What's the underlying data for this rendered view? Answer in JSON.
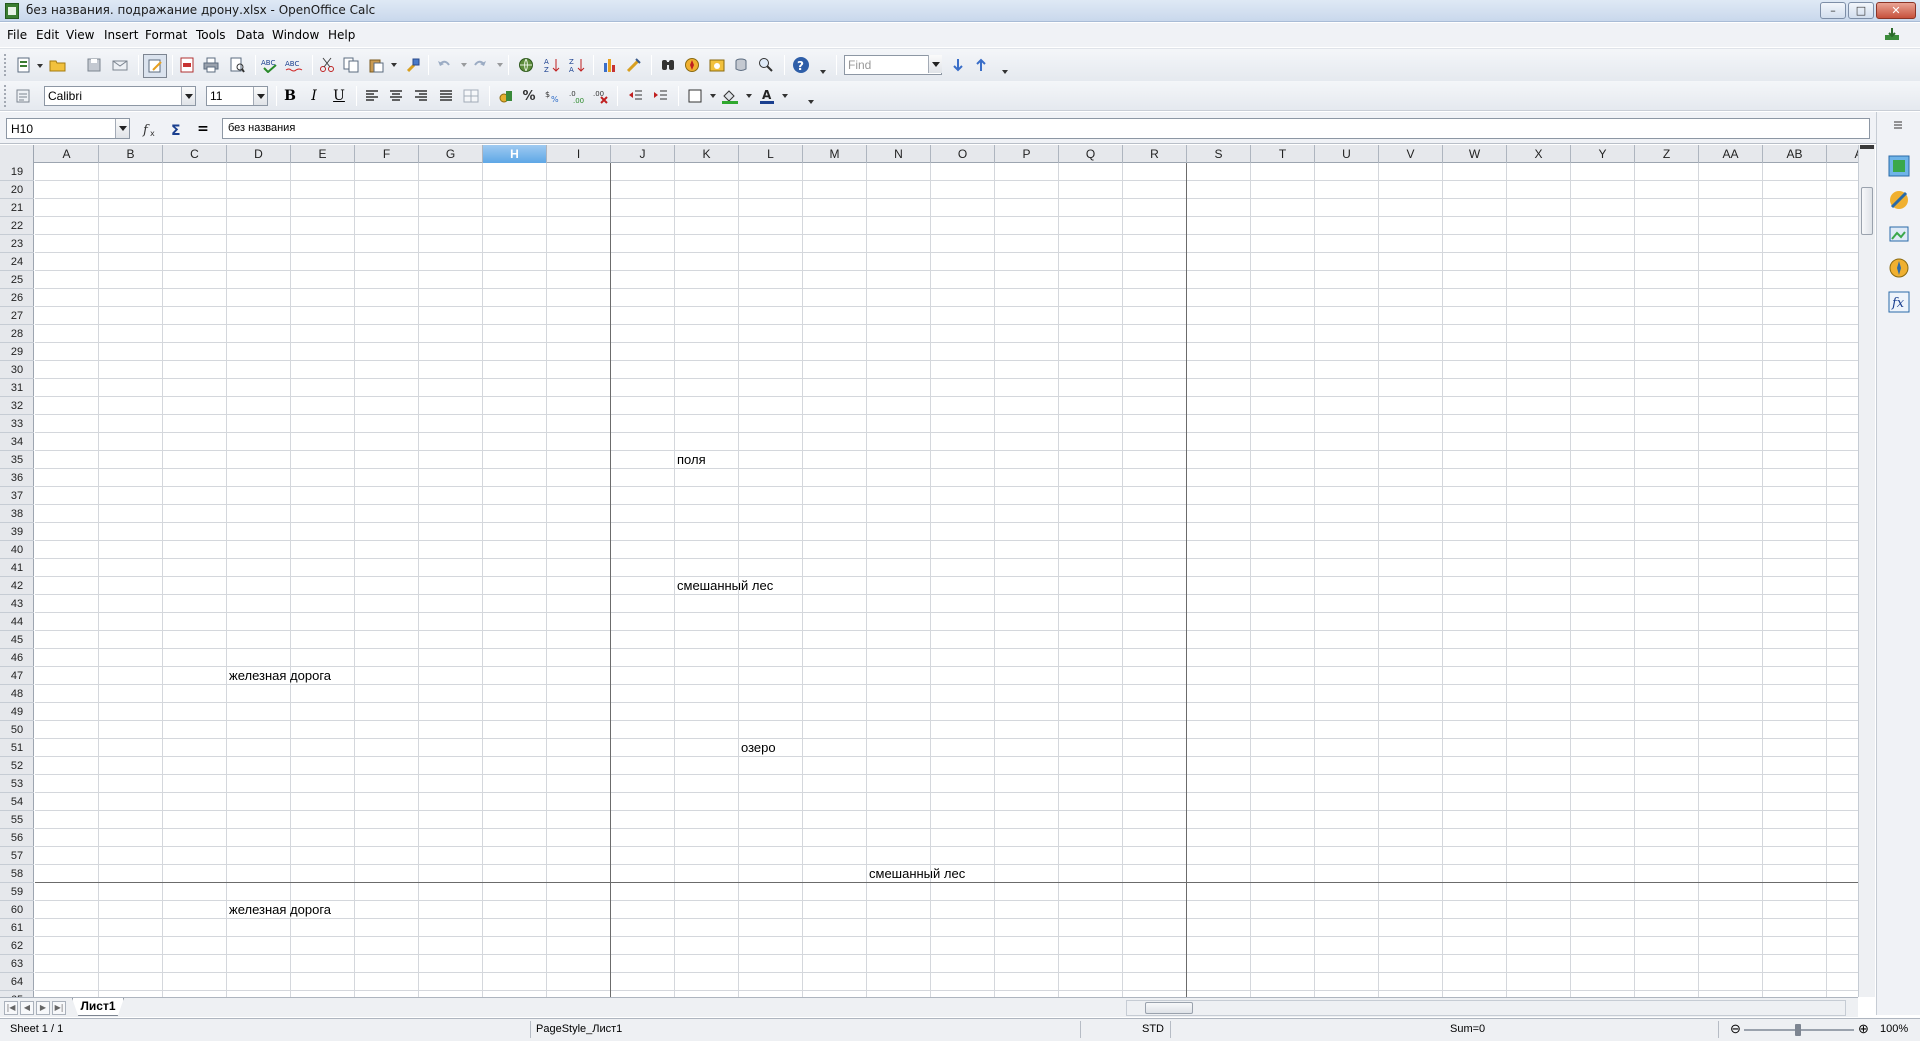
{
  "window": {
    "title": "без названия. подражание дрону.xlsx - OpenOffice Calc",
    "controls": {
      "minimize": "–",
      "maximize": "□",
      "close": "✕"
    }
  },
  "menu": {
    "items": [
      {
        "label": "File"
      },
      {
        "label": "Edit"
      },
      {
        "label": "View"
      },
      {
        "label": "Insert"
      },
      {
        "label": "Format"
      },
      {
        "label": "Tools"
      },
      {
        "label": "Data"
      },
      {
        "label": "Window"
      },
      {
        "label": "Help"
      }
    ]
  },
  "toolbar": {
    "find_placeholder": "Find",
    "font_name": "Calibri",
    "font_size": "11",
    "bold": "B",
    "italic": "I",
    "underline": "U",
    "percent": "%"
  },
  "formula_bar": {
    "cell_ref": "H10",
    "content": "без названия",
    "equals": "="
  },
  "sheet": {
    "columns": [
      "A",
      "B",
      "C",
      "D",
      "E",
      "F",
      "G",
      "H",
      "I",
      "J",
      "K",
      "L",
      "M",
      "N",
      "O",
      "P",
      "Q",
      "R",
      "S",
      "T",
      "U",
      "V",
      "W",
      "X",
      "Y",
      "Z",
      "AA",
      "AB",
      "A"
    ],
    "selected_column": "H",
    "rows": [
      "19",
      "20",
      "21",
      "22",
      "23",
      "24",
      "25",
      "26",
      "27",
      "28",
      "29",
      "30",
      "31",
      "32",
      "33",
      "34",
      "35",
      "36",
      "37",
      "38",
      "39",
      "40",
      "41",
      "42",
      "43",
      "44",
      "45",
      "46",
      "47",
      "48",
      "49",
      "50",
      "51",
      "52",
      "53",
      "54",
      "55",
      "56",
      "57",
      "58",
      "59",
      "60",
      "61",
      "62",
      "63",
      "64",
      "65"
    ],
    "cells": [
      {
        "ref": "K35",
        "text": "поля"
      },
      {
        "ref": "K42",
        "text": "смешанный лес"
      },
      {
        "ref": "D47",
        "text": "железная дорога"
      },
      {
        "ref": "L51",
        "text": "озеро"
      },
      {
        "ref": "N58",
        "text": "смешанный лес"
      },
      {
        "ref": "D60",
        "text": "железная дорога"
      }
    ],
    "tabs": [
      {
        "label": "Лист1",
        "active": true
      }
    ]
  },
  "status": {
    "sheet": "Sheet 1 / 1",
    "page_style": "PageStyle_Лист1",
    "mode": "STD",
    "sum": "Sum=0",
    "zoom": "100%"
  },
  "colors": {
    "selected_header": "#5ea7e6",
    "grid_line": "#d4d7dc",
    "page_break": "#6b6b6b"
  }
}
